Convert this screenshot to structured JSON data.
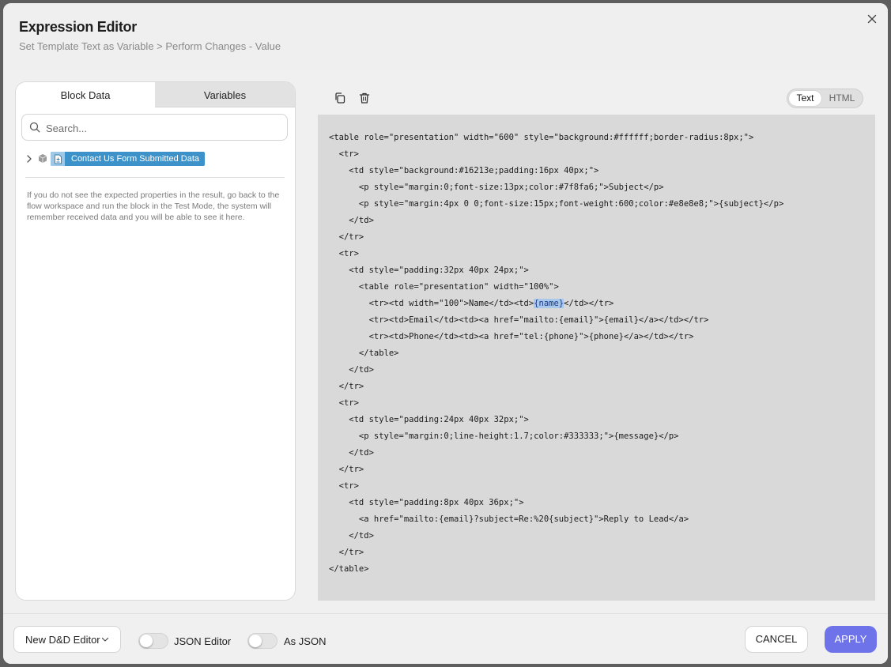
{
  "header": {
    "title": "Expression Editor",
    "breadcrumb": "Set Template Text as Variable > Perform Changes - Value"
  },
  "left_panel": {
    "tabs": [
      {
        "label": "Block Data",
        "active": true
      },
      {
        "label": "Variables",
        "active": false
      }
    ],
    "search": {
      "placeholder": "Search...",
      "value": ""
    },
    "tree": {
      "node_label": "Contact Us Form Submitted Data",
      "expanded": false
    },
    "hint": "If you do not see the expected properties in the result, go back to the flow workspace and run the block in the Test Mode, the system will remember received data and you will be able to see it here."
  },
  "editor": {
    "toolbar": {
      "copy_icon": "copy-icon",
      "delete_icon": "trash-icon"
    },
    "mode_toggle": {
      "options": [
        "Text",
        "HTML"
      ],
      "selected": "Text"
    },
    "code_lines": [
      "<table role=\"presentation\" width=\"600\" style=\"background:#ffffff;border-radius:8px;\">",
      "  <tr>",
      "    <td style=\"background:#16213e;padding:16px 40px;\">",
      "      <p style=\"margin:0;font-size:13px;color:#7f8fa6;\">Subject</p>",
      "      <p style=\"margin:4px 0 0;font-size:15px;font-weight:600;color:#e8e8e8;\">{subject}</p>",
      "    </td>",
      "  </tr>",
      "  <tr>",
      "    <td style=\"padding:32px 40px 24px;\">",
      "      <table role=\"presentation\" width=\"100%\">",
      "        <tr><td width=\"100\">Name</td><td>{name}</td></tr>",
      "        <tr><td>Email</td><td><a href=\"mailto:{email}\">{email}</a></td></tr>",
      "        <tr><td>Phone</td><td><a href=\"tel:{phone}\">{phone}</a></td></tr>",
      "      </table>",
      "    </td>",
      "  </tr>",
      "  <tr>",
      "    <td style=\"padding:24px 40px 32px;\">",
      "      <p style=\"margin:0;line-height:1.7;color:#333333;\">{message}</p>",
      "    </td>",
      "  </tr>",
      "  <tr>",
      "    <td style=\"padding:8px 40px 36px;\">",
      "      <a href=\"mailto:{email}?subject=Re:%20{subject}\">Reply to Lead</a>",
      "    </td>",
      "  </tr>",
      "</table>"
    ],
    "highlighted_token": "{name}"
  },
  "footer": {
    "editor_select": "New D&D Editor",
    "json_editor_label": "JSON Editor",
    "json_editor_on": false,
    "as_json_label": "As JSON",
    "as_json_on": false,
    "cancel_label": "CANCEL",
    "apply_label": "APPLY"
  },
  "colors": {
    "accent": "#6f73ea",
    "node_chip": "#3c92c9",
    "code_bg": "#d9d9d9",
    "selection": "#a9c8eb"
  }
}
